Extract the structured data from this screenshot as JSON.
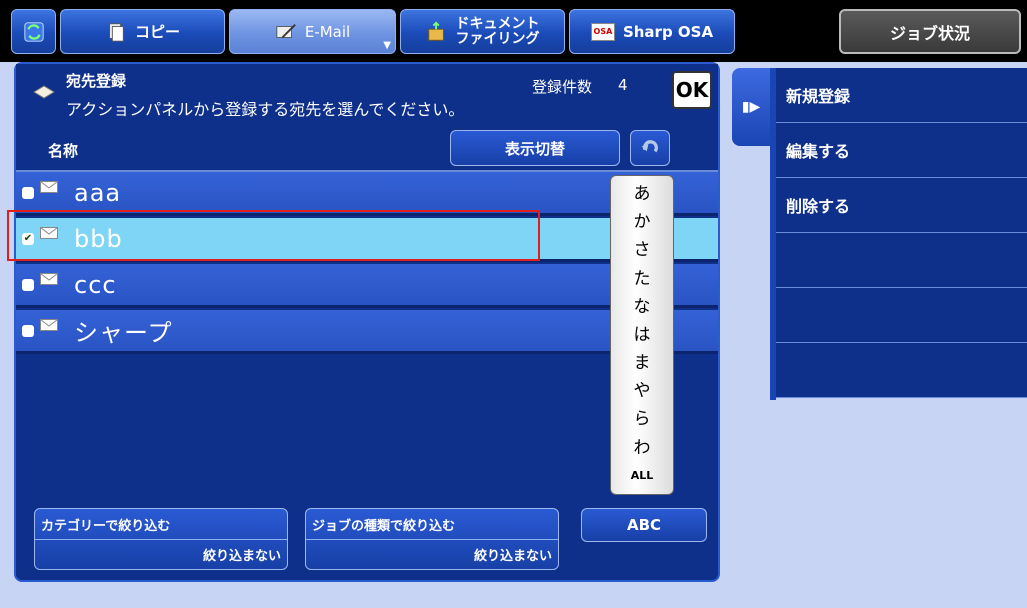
{
  "tabs": [
    {
      "label": "コピー"
    },
    {
      "label": "E-Mail"
    },
    {
      "label_line1": "ドキュメント",
      "label_line2": "ファイリング"
    },
    {
      "label": "Sharp OSA",
      "icon_text": "OSA"
    }
  ],
  "job_status": "ジョブ状況",
  "header": {
    "title": "宛先登録",
    "instruction": "アクションパネルから登録する宛先を選んでください。",
    "count_label": "登録件数",
    "count_value": "4",
    "ok_label": "OK"
  },
  "column_header": {
    "name": "名称",
    "toggle_view": "表示切替"
  },
  "entries": [
    {
      "name": "aaa",
      "checked": false
    },
    {
      "name": "bbb",
      "checked": true
    },
    {
      "name": "ccc",
      "checked": false
    },
    {
      "name": "シャープ",
      "checked": false
    }
  ],
  "kana_index": [
    "あ",
    "か",
    "さ",
    "た",
    "な",
    "は",
    "ま",
    "や",
    "ら",
    "わ",
    "ALL"
  ],
  "filters": {
    "category": {
      "title": "カテゴリーで絞り込む",
      "value": "絞り込まない"
    },
    "job_type": {
      "title": "ジョブの種類で絞り込む",
      "value": "絞り込まない"
    },
    "abc": "ABC"
  },
  "action_panel": [
    "新規登録",
    "編集する",
    "削除する",
    "",
    "",
    ""
  ],
  "colors": {
    "panel": "#0e2f8a",
    "row": "#3462d6",
    "selected_row": "#7fd5f6",
    "highlight": "#e02020"
  }
}
